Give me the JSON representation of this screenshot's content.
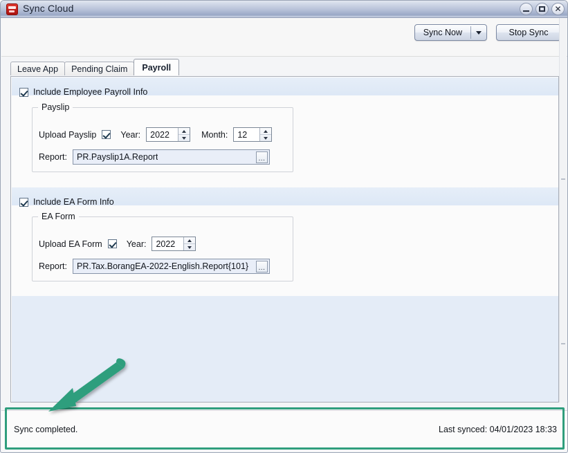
{
  "window": {
    "title": "Sync Cloud",
    "icon": "app-icon",
    "controls": {
      "minimize": "minimize-icon",
      "maximize": "maximize-icon",
      "close": "close-icon"
    }
  },
  "toolbar": {
    "sync_now_label": "Sync Now",
    "sync_now_dropdown_icon": "chevron-down-icon",
    "stop_sync_label": "Stop Sync"
  },
  "tabs": [
    {
      "label": "Leave App",
      "active": false
    },
    {
      "label": "Pending Claim",
      "active": false
    },
    {
      "label": "Payroll",
      "active": true
    }
  ],
  "payroll": {
    "include_payroll": {
      "label": "Include Employee Payroll Info",
      "checked": true
    },
    "payslip_group": {
      "legend": "Payslip",
      "upload_label": "Upload Payslip",
      "upload_checked": true,
      "year_label": "Year:",
      "year_value": "2022",
      "month_label": "Month:",
      "month_value": "12",
      "report_label": "Report:",
      "report_value": "PR.Payslip1A.Report",
      "browse_label": "...",
      "spinner_up_icon": "triangle-up-icon",
      "spinner_down_icon": "triangle-down-icon"
    },
    "include_ea": {
      "label": "Include EA Form Info",
      "checked": true
    },
    "ea_group": {
      "legend": "EA Form",
      "upload_label": "Upload EA Form",
      "upload_checked": true,
      "year_label": "Year:",
      "year_value": "2022",
      "report_label": "Report:",
      "report_value": "PR.Tax.BorangEA-2022-English.Report{101}",
      "browse_label": "...",
      "spinner_up_icon": "triangle-up-icon",
      "spinner_down_icon": "triangle-down-icon"
    }
  },
  "statusbar": {
    "message": "Sync completed.",
    "last_synced": "Last synced: 04/01/2023 18:33"
  },
  "annotations": {
    "highlight_color": "#2f9e7d",
    "arrow_color": "#2f9e7d",
    "arrow_target": "status-bar"
  }
}
